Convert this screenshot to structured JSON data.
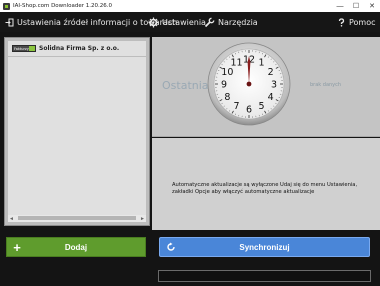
{
  "window": {
    "title": "IAI-Shop.com Downloader 1.20.26.0",
    "controls": {
      "minimize": "—",
      "maximize": "☐",
      "close": "✕"
    }
  },
  "menu": {
    "sources_label": "Ustawienia źródeł informacji o towarach",
    "settings_label": "Ustawienia",
    "tools_label": "Narzędzia",
    "help_label": "Pomoc"
  },
  "sources": {
    "items": [
      {
        "logo_text": "Fakturzy",
        "name": "Solidna Firma Sp. z o.o."
      }
    ],
    "scroll_left": "◄",
    "scroll_right": "►"
  },
  "status": {
    "last_label": "Ostatnia",
    "no_data": "brak danych",
    "clock_numbers": [
      "12",
      "1",
      "2",
      "3",
      "4",
      "5",
      "6",
      "7",
      "8",
      "9",
      "10",
      "11"
    ],
    "auto_update_message": "Automatyczne aktualizacje są wyłączone Udaj się do menu Ustawienia, zakładki Opcje aby włączyć automatyczne aktualizacje"
  },
  "buttons": {
    "add_label": "Dodaj",
    "add_icon": "+",
    "sync_label": "Synchronizuj"
  },
  "colors": {
    "add_green": "#5f9c2d",
    "sync_blue": "#4a86d8",
    "clock_hand": "#8b1f1f"
  }
}
